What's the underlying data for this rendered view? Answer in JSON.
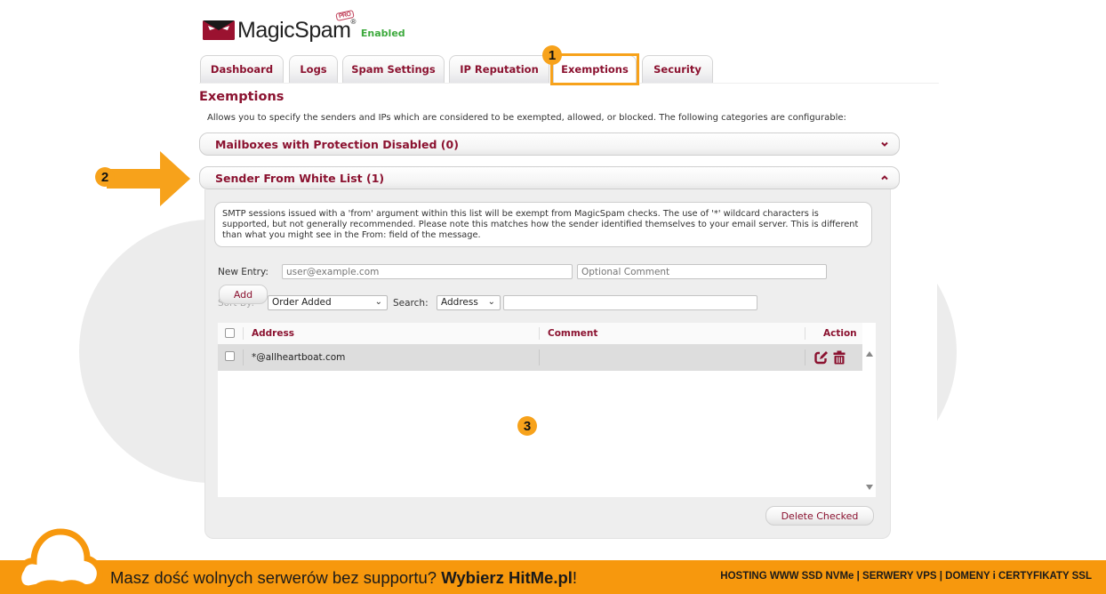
{
  "app": {
    "logo_text": "MagicSpam",
    "logo_badge": "PRO",
    "logo_reg": "®",
    "status": "Enabled"
  },
  "tabs": [
    {
      "label": "Dashboard",
      "active": false
    },
    {
      "label": "Logs",
      "active": false
    },
    {
      "label": "Spam Settings",
      "active": false
    },
    {
      "label": "IP Reputation",
      "active": false
    },
    {
      "label": "Exemptions",
      "active": true
    },
    {
      "label": "Security",
      "active": false
    }
  ],
  "page": {
    "title": "Exemptions",
    "description": "Allows you to specify the senders and IPs which are considered to be exempted, allowed, or blocked. The following categories are configurable:"
  },
  "sections": [
    {
      "title": "Mailboxes with Protection Disabled (0)",
      "expanded": false
    },
    {
      "title": "Sender From White List (1)",
      "expanded": true
    }
  ],
  "whitelist": {
    "info": "SMTP sessions issued with a 'from' argument within this list will be exempt from MagicSpam checks. The use of '*' wildcard characters is supported, but not generally recommended. Please note this matches how the sender identified themselves to your email server. This is different than what you might see in the From: field of the message.",
    "new_entry_label": "New Entry:",
    "new_entry_placeholder": "user@example.com",
    "comment_placeholder": "Optional Comment",
    "add_label": "Add",
    "sort_by_label": "Sort By:",
    "sort_by_value": "Order Added",
    "search_label": "Search:",
    "search_field_value": "Address",
    "search_value": "",
    "columns": {
      "address": "Address",
      "comment": "Comment",
      "action": "Action"
    },
    "rows": [
      {
        "address": "*@allheartboat.com",
        "comment": "",
        "checked": false
      }
    ],
    "delete_label": "Delete Checked"
  },
  "annotations": {
    "marker_1": "1",
    "marker_2": "2",
    "marker_3": "3"
  },
  "footer": {
    "message_plain": "Masz dość wolnych serwerów bez supportu? ",
    "message_bold": "Wybierz HitMe.pl",
    "message_end": "!",
    "services": "HOSTING WWW SSD NVMe | SERWERY VPS | DOMENY i CERTYFIKATY SSL"
  },
  "colors": {
    "brand": "#8b1230",
    "enabled": "#3daa3d",
    "annotation": "#f7a21b",
    "footer": "#f7980d"
  }
}
